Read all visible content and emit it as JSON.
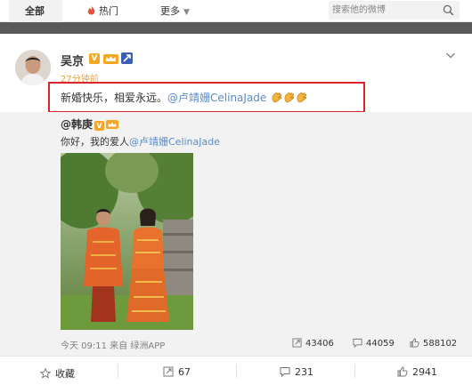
{
  "nav": {
    "tabs": [
      {
        "label": "全部"
      },
      {
        "label": "热门"
      },
      {
        "label": "更多"
      }
    ],
    "search_placeholder": "搜索他的微博"
  },
  "post": {
    "author": "吴京",
    "time": "27分钟前",
    "text": "新婚快乐，相爱永远。",
    "mention": "@卢靖姗CelinaJade"
  },
  "repost": {
    "author": "@韩庚",
    "text": "你好，我的爱人",
    "mention": "@卢靖姗CelinaJade",
    "meta": "今天 09:11 来自 绿洲APP",
    "stats": {
      "reposts": "43406",
      "comments": "44059",
      "likes": "588102"
    }
  },
  "footer": {
    "favorite_label": "收藏",
    "repost_count": "67",
    "comment_count": "231",
    "like_count": "2941"
  },
  "colors": {
    "accent_orange": "#f0a23c",
    "mention_blue": "#5a8ac9",
    "highlight_red": "#d9262b"
  }
}
